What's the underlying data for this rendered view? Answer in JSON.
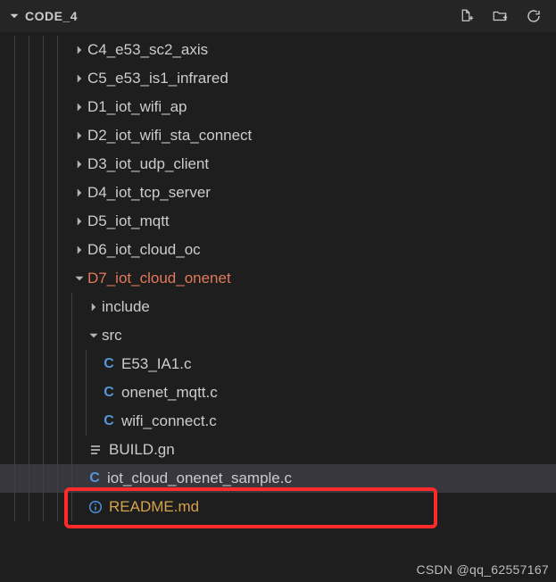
{
  "header": {
    "title": "CODE_4"
  },
  "tree": {
    "folders": [
      "C4_e53_sc2_axis",
      "C5_e53_is1_infrared",
      "D1_iot_wifi_ap",
      "D2_iot_wifi_sta_connect",
      "D3_iot_udp_client",
      "D4_iot_tcp_server",
      "D5_iot_mqtt",
      "D6_iot_cloud_oc"
    ],
    "open_folder": "D7_iot_cloud_onenet",
    "include_folder": "include",
    "src_folder": "src",
    "src_files": [
      "E53_IA1.c",
      "onenet_mqtt.c",
      "wifi_connect.c"
    ],
    "build_file": "BUILD.gn",
    "sample_file": "iot_cloud_onenet_sample.c",
    "readme": "README.md"
  },
  "watermark": "CSDN @qq_62557167"
}
